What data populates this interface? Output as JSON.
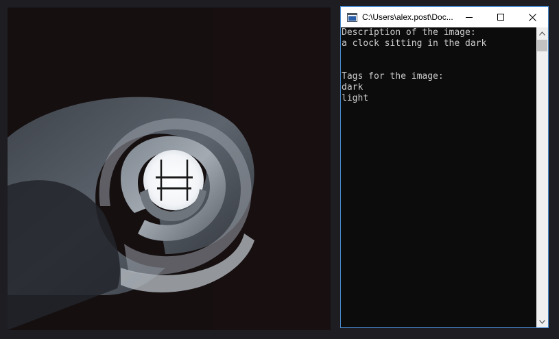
{
  "photo": {
    "subject": "spiral-staircase-photo"
  },
  "console": {
    "title": "C:\\Users\\alex.post\\Doc...",
    "lines": [
      "Description of the image:",
      "a clock sitting in the dark",
      "",
      "",
      "Tags for the image:",
      "dark",
      "light"
    ],
    "buttons": {
      "minimize_icon": "minimize-icon",
      "maximize_icon": "maximize-icon",
      "close_icon": "close-icon"
    },
    "colors": {
      "background": "#0c0c0c",
      "text": "#cccccc",
      "border_accent": "#4a8fd6"
    }
  }
}
